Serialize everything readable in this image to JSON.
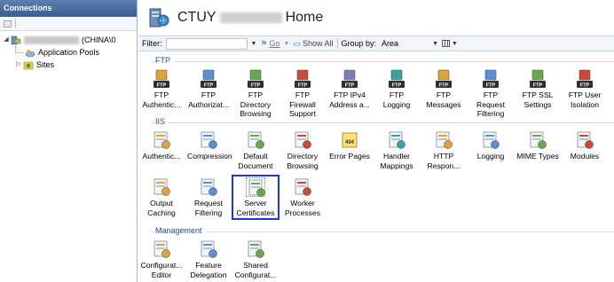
{
  "connections": {
    "title": "Connections",
    "server_suffix": "(CHINA\\0",
    "items": [
      "Application Pools",
      "Sites"
    ]
  },
  "header": {
    "title_prefix": "CTUY",
    "title_suffix": "Home"
  },
  "filterbar": {
    "filter_label": "Filter:",
    "go_label": "Go",
    "show_all_label": "Show All",
    "group_by_label": "Group by:",
    "group_by_value": "Area"
  },
  "sections": {
    "ftp": "FTP",
    "iis": "IIS",
    "management": "Management"
  },
  "ftp_tiles": [
    {
      "label": "FTP\nAuthentic...",
      "icon": "ftp-authentication-icon"
    },
    {
      "label": "FTP\nAuthorizat...",
      "icon": "ftp-authorization-icon"
    },
    {
      "label": "FTP Directory\nBrowsing",
      "icon": "ftp-directory-browsing-icon"
    },
    {
      "label": "FTP Firewall\nSupport",
      "icon": "ftp-firewall-icon"
    },
    {
      "label": "FTP IPv4\nAddress a...",
      "icon": "ftp-ipv4-icon"
    },
    {
      "label": "FTP Logging",
      "icon": "ftp-logging-icon"
    },
    {
      "label": "FTP\nMessages",
      "icon": "ftp-messages-icon"
    },
    {
      "label": "FTP Request\nFiltering",
      "icon": "ftp-request-filtering-icon"
    },
    {
      "label": "FTP SSL\nSettings",
      "icon": "ftp-ssl-icon"
    },
    {
      "label": "FTP User\nIsolation",
      "icon": "ftp-user-isolation-icon"
    }
  ],
  "iis_tiles_row1": [
    {
      "label": "Authentic...",
      "icon": "authentication-icon"
    },
    {
      "label": "Compression",
      "icon": "compression-icon"
    },
    {
      "label": "Default\nDocument",
      "icon": "default-document-icon"
    },
    {
      "label": "Directory\nBrowsing",
      "icon": "directory-browsing-icon"
    },
    {
      "label": "Error Pages",
      "icon": "error-pages-icon",
      "badge": "404"
    },
    {
      "label": "Handler\nMappings",
      "icon": "handler-mappings-icon"
    },
    {
      "label": "HTTP\nRespon...",
      "icon": "http-response-icon"
    },
    {
      "label": "Logging",
      "icon": "logging-icon"
    },
    {
      "label": "MIME Types",
      "icon": "mime-types-icon"
    },
    {
      "label": "Modules",
      "icon": "modules-icon"
    }
  ],
  "iis_tiles_row2": [
    {
      "label": "Output\nCaching",
      "icon": "output-caching-icon"
    },
    {
      "label": "Request\nFiltering",
      "icon": "request-filtering-icon"
    },
    {
      "label": "Server\nCertificates",
      "icon": "server-certificates-icon",
      "selected": true
    },
    {
      "label": "Worker\nProcesses",
      "icon": "worker-processes-icon"
    }
  ],
  "management_tiles": [
    {
      "label": "Configurat...\nEditor",
      "icon": "configuration-editor-icon"
    },
    {
      "label": "Feature\nDelegation",
      "icon": "feature-delegation-icon"
    },
    {
      "label": "Shared\nConfigurat...",
      "icon": "shared-configuration-icon"
    }
  ],
  "ftp_badge": "FTP",
  "colors": {
    "accent": "#1f4b92",
    "selection": "#1c38d8",
    "pane_header": "#3b5d92"
  }
}
